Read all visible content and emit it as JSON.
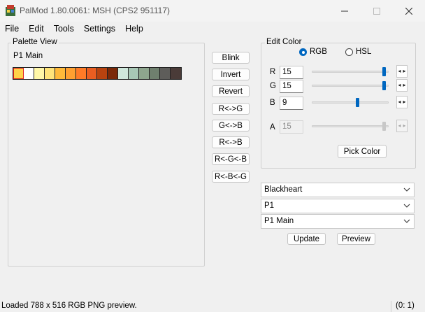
{
  "window": {
    "title": "PalMod 1.80.0061: MSH (CPS2 951117)",
    "minimize_icon": "minimize-icon",
    "maximize_icon": "maximize-icon",
    "close_icon": "close-icon"
  },
  "menu": [
    "File",
    "Edit",
    "Tools",
    "Settings",
    "Help"
  ],
  "palette_view": {
    "group_label": "Palette View",
    "palette_name": "P1 Main",
    "swatches": [
      "#ffd24a",
      "#ffffff",
      "#fff7a8",
      "#ffe47a",
      "#ffba3a",
      "#ffa031",
      "#ff7b27",
      "#ea5e21",
      "#b8430f",
      "#7a2908",
      "#cfe8dc",
      "#a8c8b6",
      "#8ea68e",
      "#6f806e",
      "#5e5d5a",
      "#4a3b38"
    ],
    "selected_index": 0
  },
  "actions": [
    "Blink",
    "Invert",
    "Revert",
    "R<->G",
    "G<->B",
    "R<->B",
    "R<-G<-B",
    "R<-B<-G"
  ],
  "edit_color": {
    "group_label": "Edit Color",
    "mode_rgb": "RGB",
    "mode_hsl": "HSL",
    "selected_mode": "RGB",
    "channels": [
      {
        "label": "R",
        "value": "15",
        "level": 0.96
      },
      {
        "label": "G",
        "value": "15",
        "level": 0.96
      },
      {
        "label": "B",
        "value": "9",
        "level": 0.6
      },
      {
        "label": "A",
        "value": "15",
        "level": 0.96,
        "disabled": true
      }
    ],
    "spin_glyphs": "◂▸",
    "pick_color_label": "Pick Color"
  },
  "selectors": {
    "game": "Blackheart",
    "palette": "P1",
    "sub_palette": "P1 Main"
  },
  "update_label": "Update",
  "preview_label": "Preview",
  "status": {
    "message": "Loaded 788 x 516 RGB PNG preview.",
    "coords": "(0: 1)"
  },
  "colors": {
    "accent": "#0067c0",
    "selection": "#e02020"
  }
}
